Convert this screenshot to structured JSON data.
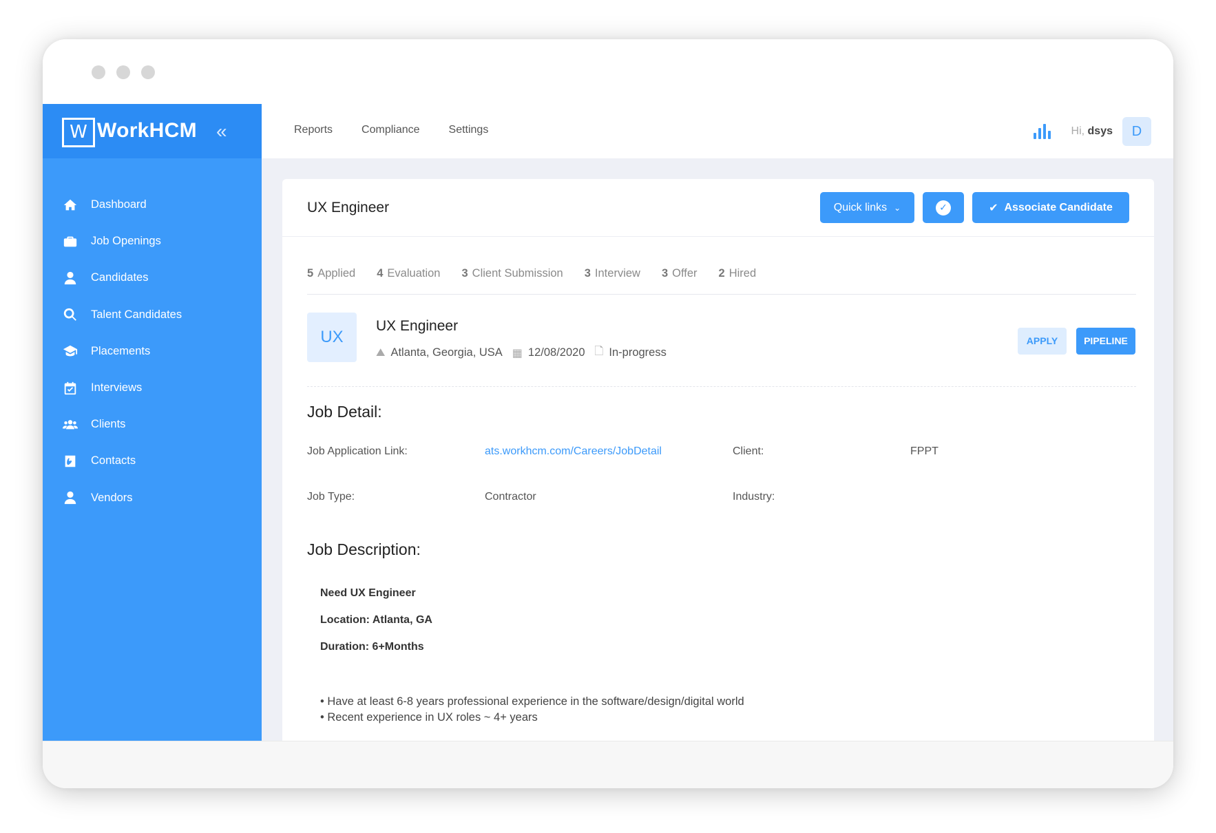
{
  "app": {
    "brand": "WorkHCM",
    "logo_letter": "W"
  },
  "sidebar": {
    "items": [
      {
        "label": "Dashboard",
        "icon": "home-icon"
      },
      {
        "label": "Job Openings",
        "icon": "briefcase-icon"
      },
      {
        "label": "Candidates",
        "icon": "user-tie-icon"
      },
      {
        "label": "Talent Candidates",
        "icon": "search-icon"
      },
      {
        "label": "Placements",
        "icon": "graduation-cap-icon"
      },
      {
        "label": "Interviews",
        "icon": "calendar-check-icon"
      },
      {
        "label": "Clients",
        "icon": "users-icon"
      },
      {
        "label": "Contacts",
        "icon": "contact-book-icon"
      },
      {
        "label": "Vendors",
        "icon": "user-tie-icon"
      }
    ]
  },
  "topbar": {
    "nav": [
      "Reports",
      "Compliance",
      "Settings"
    ],
    "greeting": "Hi,",
    "username": "dsys",
    "avatar_letter": "D"
  },
  "card": {
    "title": "UX Engineer",
    "quick_links": "Quick links",
    "associate": "Associate Candidate"
  },
  "stages": [
    {
      "count": "5",
      "label": "Applied"
    },
    {
      "count": "4",
      "label": "Evaluation"
    },
    {
      "count": "3",
      "label": "Client Submission"
    },
    {
      "count": "3",
      "label": "Interview"
    },
    {
      "count": "3",
      "label": "Offer"
    },
    {
      "count": "2",
      "label": "Hired"
    }
  ],
  "job": {
    "badge": "UX",
    "name": "UX Engineer",
    "location": "Atlanta, Georgia, USA",
    "date": "12/08/2020",
    "status": "In-progress",
    "apply": "APPLY",
    "pipeline": "PIPELINE"
  },
  "detail": {
    "heading": "Job Detail:",
    "app_link_label": "Job Application Link:",
    "app_link": "ats.workhcm.com/Careers/JobDetail",
    "client_label": "Client:",
    "client": "FPPT",
    "type_label": "Job Type:",
    "type": "Contractor",
    "industry_label": "Industry:"
  },
  "description": {
    "heading": "Job Description:",
    "lines": [
      "Need UX Engineer",
      "Location: Atlanta, GA",
      "Duration: 6+Months"
    ],
    "bullets": [
      "• Have at least 6-8 years professional experience in the software/design/digital world",
      "• Recent experience in UX roles ~ 4+ years"
    ]
  },
  "colors": {
    "accent": "#3c9afa",
    "sidebar_header": "#2c8cf4",
    "background": "#eef0f6"
  }
}
